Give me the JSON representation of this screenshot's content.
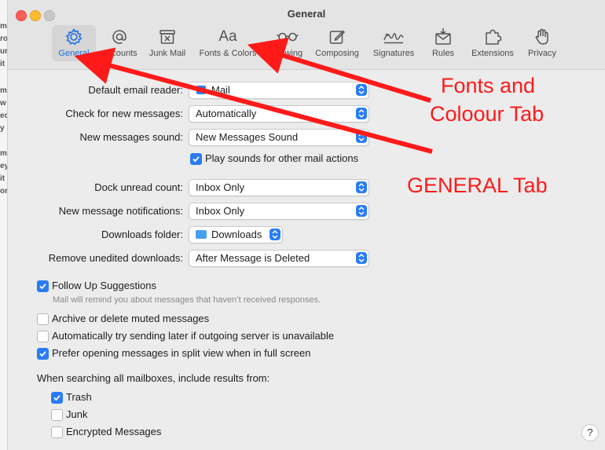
{
  "window": {
    "title": "General"
  },
  "toolbar": {
    "tabs": [
      {
        "label": "General",
        "icon": "gear-icon",
        "active": true
      },
      {
        "label": "Accounts",
        "icon": "at-sign-icon"
      },
      {
        "label": "Junk Mail",
        "icon": "junk-mail-icon"
      },
      {
        "label": "Fonts & Colors",
        "icon": "fonts-icon",
        "glyph": "Aa"
      },
      {
        "label": "Viewing",
        "icon": "glasses-icon"
      },
      {
        "label": "Composing",
        "icon": "compose-icon"
      },
      {
        "label": "Signatures",
        "icon": "signature-icon"
      },
      {
        "label": "Rules",
        "icon": "rules-icon"
      },
      {
        "label": "Extensions",
        "icon": "extensions-icon"
      },
      {
        "label": "Privacy",
        "icon": "hand-icon"
      }
    ]
  },
  "settings": {
    "default_email_reader": {
      "label": "Default email reader:",
      "value": "Mail"
    },
    "check_new_messages": {
      "label": "Check for new messages:",
      "value": "Automatically"
    },
    "new_messages_sound": {
      "label": "New messages sound:",
      "value": "New Messages Sound"
    },
    "play_sounds": {
      "label": "Play sounds for other mail actions",
      "checked": true
    },
    "dock_unread_count": {
      "label": "Dock unread count:",
      "value": "Inbox Only"
    },
    "new_message_notifications": {
      "label": "New message notifications:",
      "value": "Inbox Only"
    },
    "downloads_folder": {
      "label": "Downloads folder:",
      "value": "Downloads"
    },
    "remove_unedited_downloads": {
      "label": "Remove unedited downloads:",
      "value": "After Message is Deleted"
    }
  },
  "checkboxes": {
    "follow_up": {
      "label": "Follow Up Suggestions",
      "checked": true
    },
    "follow_up_note": "Mail will remind you about messages that haven’t received responses.",
    "archive_muted": {
      "label": "Archive or delete muted messages",
      "checked": false
    },
    "try_later": {
      "label": "Automatically try sending later if outgoing server is unavailable",
      "checked": false
    },
    "split_view": {
      "label": "Prefer opening messages in split view when in full screen",
      "checked": true
    }
  },
  "search": {
    "heading": "When searching all mailboxes, include results from:",
    "trash": {
      "label": "Trash",
      "checked": true
    },
    "junk": {
      "label": "Junk",
      "checked": false
    },
    "encrypted": {
      "label": "Encrypted Messages",
      "checked": false
    }
  },
  "help_label": "?",
  "annotations": {
    "fonts_line1": "Fonts and",
    "fonts_line2": "Coloour Tab",
    "general": "GENERAL Tab",
    "color": "#ff1a1a"
  },
  "accent_color": "#2a7cf6",
  "background_window": {
    "fragments": [
      "m",
      "ro",
      "ur",
      "it",
      "m",
      "w",
      "ec",
      "y",
      "m",
      "ey",
      "it",
      "or"
    ]
  }
}
